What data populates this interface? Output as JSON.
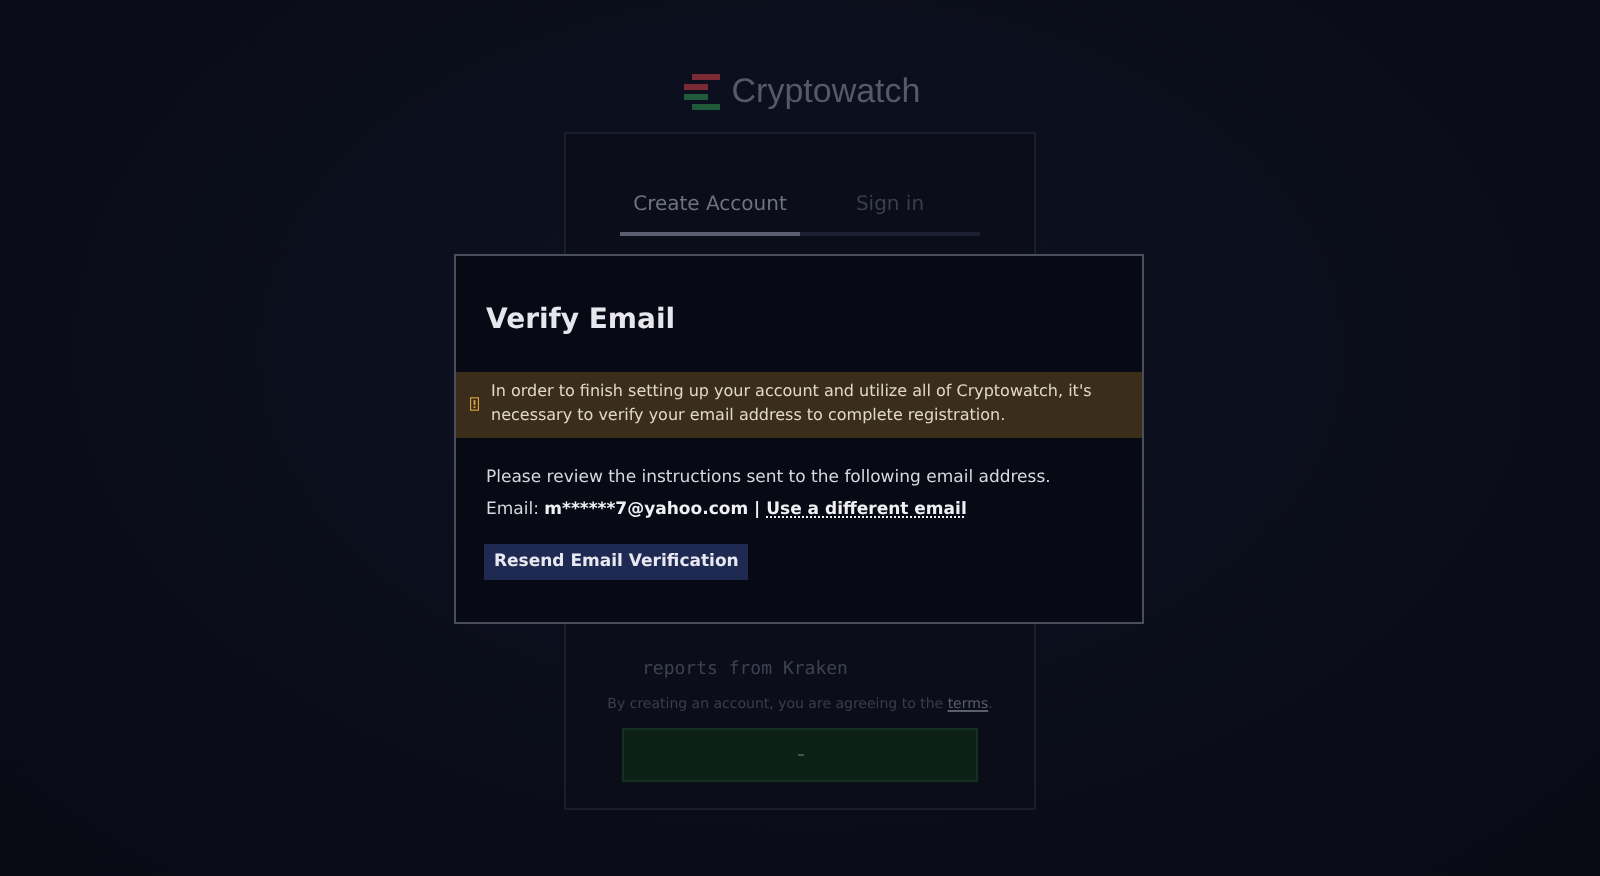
{
  "logo": {
    "text": "Cryptowatch"
  },
  "tabs": [
    {
      "label": "Create Account",
      "selected": true
    },
    {
      "label": "Sign in",
      "selected": false
    }
  ],
  "newsletter": {
    "label": "reports from Kraken"
  },
  "terms": {
    "text": "By creating an account, you are agreeing to the ",
    "link": "terms",
    "end": "."
  },
  "modal": {
    "title": "Verify Email",
    "warning": "In order to finish setting up your account and utilize all of Cryptowatch, it's necessary to verify your email address to complete registration.",
    "instructions": "Please review the instructions sent to the following email address.",
    "email_label": "Email: ",
    "email": "m******7@yahoo.com",
    "separator": " | ",
    "change_link": "Use a different email",
    "button": "Resend Email Verification"
  }
}
